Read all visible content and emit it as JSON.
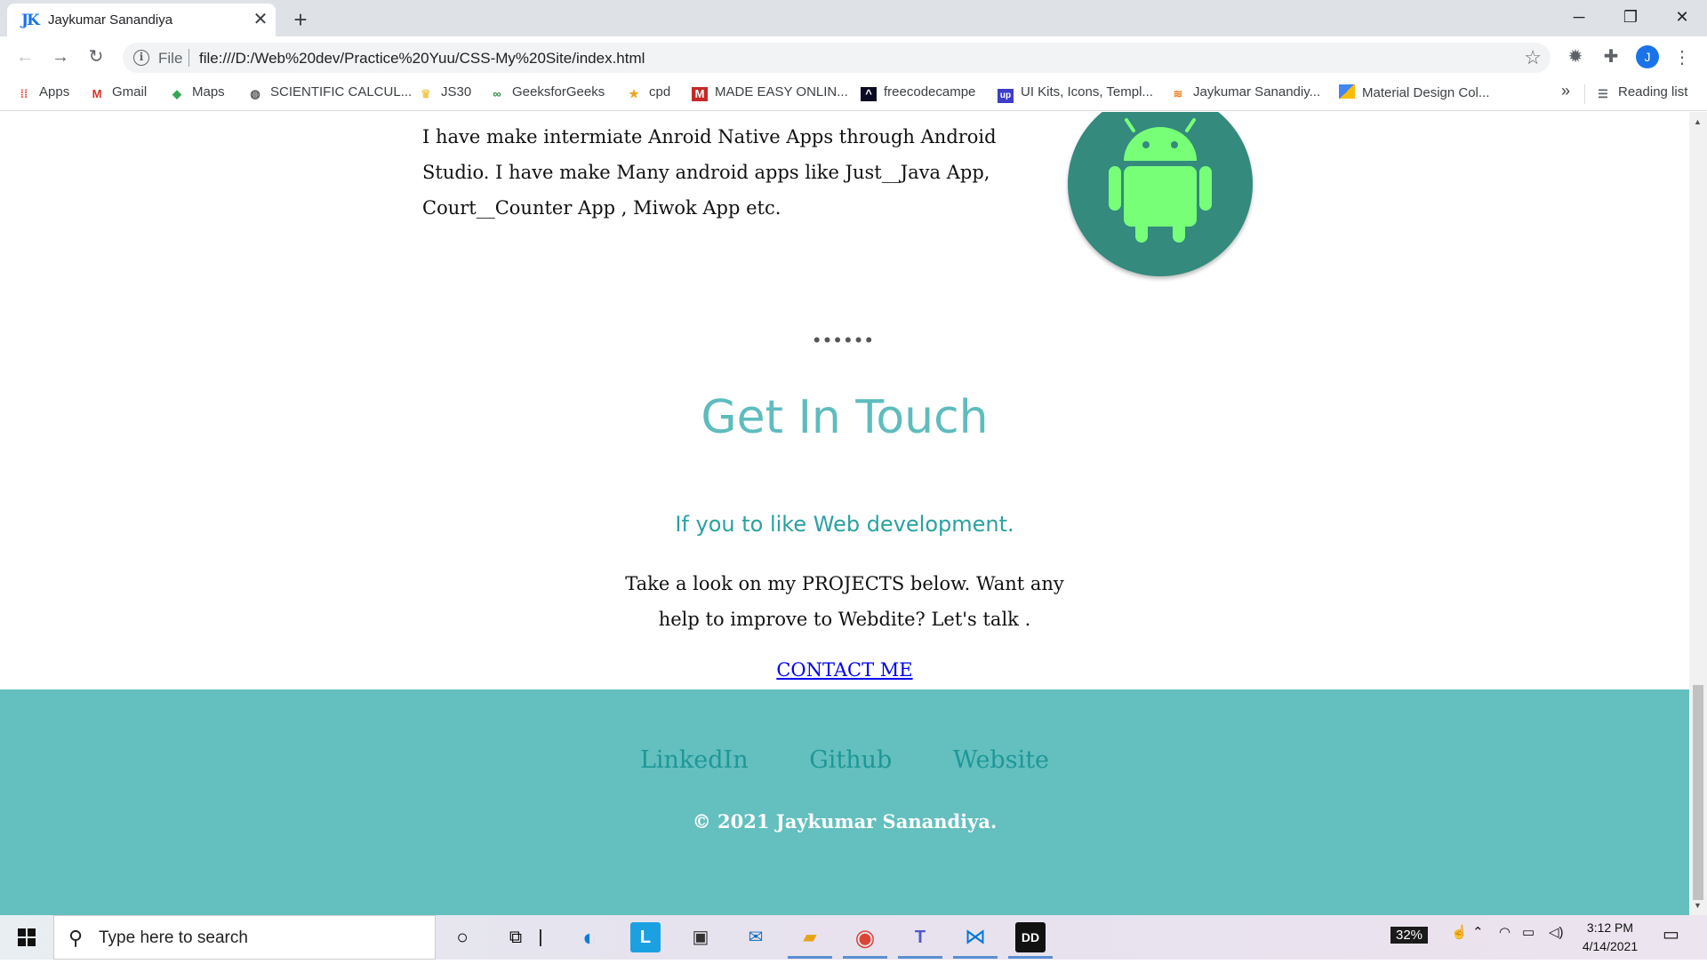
{
  "browser": {
    "tab_title": "Jaykumar Sanandiya",
    "tab_favicon": "JK",
    "url_scheme_label": "File",
    "url": "file:///D:/Web%20dev/Practice%20Yuu/CSS-My%20Site/index.html",
    "avatar_letter": "J",
    "reading_list": "Reading list",
    "bookmarks_overflow": "»"
  },
  "bookmarks": [
    {
      "label": "Apps",
      "icon": "apps-grid-icon"
    },
    {
      "label": "Gmail",
      "icon": "gmail-icon"
    },
    {
      "label": "Maps",
      "icon": "maps-icon"
    },
    {
      "label": "SCIENTIFIC CALCUL...",
      "icon": "globe-icon"
    },
    {
      "label": "JS30",
      "icon": "crown-icon"
    },
    {
      "label": "GeeksforGeeks",
      "icon": "gfg-icon"
    },
    {
      "label": "cpd",
      "icon": "cpd-icon"
    },
    {
      "label": "MADE EASY ONLIN...",
      "icon": "madeeasy-icon"
    },
    {
      "label": "freecodecampe",
      "icon": "freecodecamp-icon"
    },
    {
      "label": "UI Kits, Icons, Templ...",
      "icon": "uplabs-icon"
    },
    {
      "label": "Jaykumar Sanandiy...",
      "icon": "stackoverflow-icon"
    },
    {
      "label": "Material Design Col...",
      "icon": "material-icon"
    }
  ],
  "page": {
    "intro_text": "I have make intermiate Anroid Native Apps through Android Studio. I have make Many android apps like Just__Java App, Court__Counter App , Miwok App etc.",
    "dots": "••••••",
    "contact_title": "Get In Touch",
    "contact_subtitle": "If you to like Web development.",
    "contact_body": "Take a look on my PROJECTS below. Want any help to improve to Webdite? Let's talk .",
    "contact_link": "CONTACT ME",
    "footer_links": [
      "LinkedIn",
      "Github",
      "Website"
    ],
    "copyright": "© 2021 Jaykumar Sanandiya."
  },
  "taskbar": {
    "search_placeholder": "Type here to search",
    "battery": "32%",
    "time": "3:12 PM",
    "date": "4/14/2021"
  },
  "colors": {
    "accent_teal": "#5fbcbd",
    "footer_bg": "#64bfbf",
    "android_circle": "#338a7d",
    "android_green": "#78ff78"
  }
}
